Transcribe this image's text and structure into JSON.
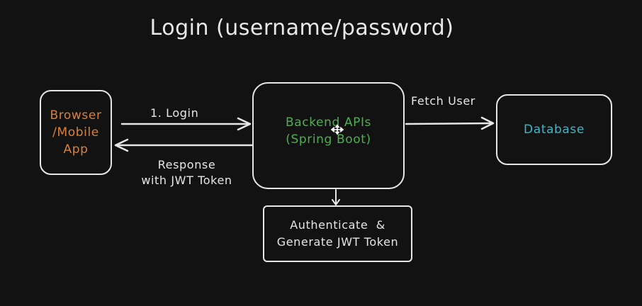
{
  "diagram": {
    "title": "Login (username/password)",
    "nodes": {
      "browser": {
        "lines": [
          "Browser",
          "/Mobile",
          "App"
        ],
        "color": "#d9813a"
      },
      "backend": {
        "lines": [
          "Backend APIs",
          "(Spring Boot)"
        ],
        "color": "#4caf50"
      },
      "database": {
        "lines": [
          "Database"
        ],
        "color": "#3fb6c7"
      },
      "auth": {
        "lines": [
          "Authenticate  &",
          "Generate JWT Token"
        ],
        "color": "#e6e6e6"
      }
    },
    "edges": {
      "login": {
        "label": "1. Login"
      },
      "response": {
        "lines": [
          "Response",
          "with JWT Token"
        ]
      },
      "fetch": {
        "label": "Fetch User"
      }
    }
  }
}
